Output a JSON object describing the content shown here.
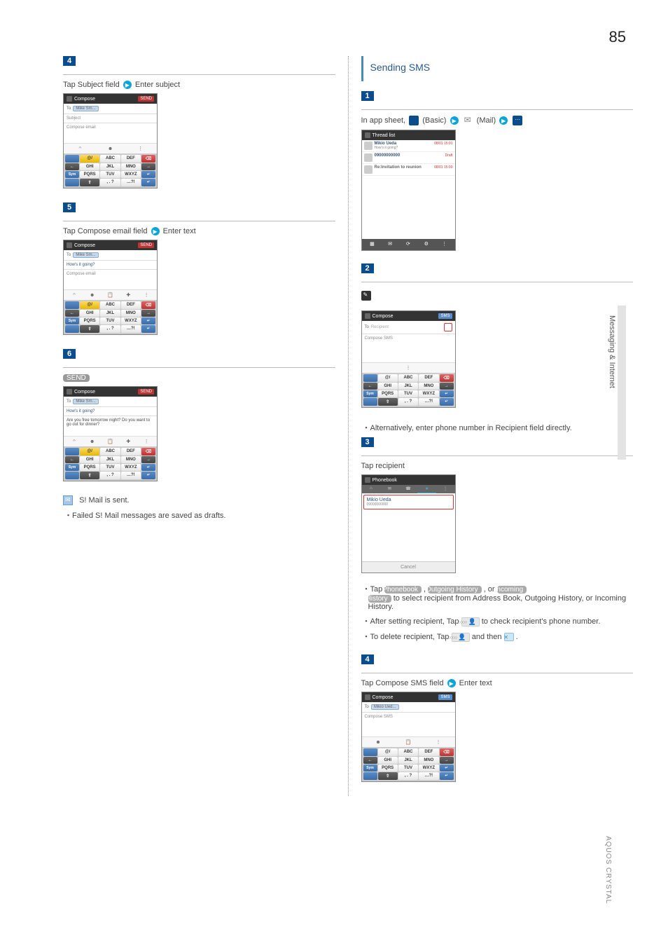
{
  "page_number": "85",
  "side_tab": "Messaging & Internet",
  "footer": "AQUOS CRYSTAL",
  "left": {
    "step4": {
      "badge": "4",
      "instr_a": "Tap Subject field",
      "instr_b": "Enter subject",
      "screen": {
        "header": "Compose",
        "send": "SEND",
        "to_label": "To",
        "chip": "Mike Sm...",
        "subject": "Subject",
        "body": "Compose email"
      }
    },
    "step5": {
      "badge": "5",
      "instr_a": "Tap Compose email field",
      "instr_b": "Enter text",
      "screen": {
        "header": "Compose",
        "send": "SEND",
        "to_label": "To",
        "chip": "Mike Sm...",
        "subject": "How's it going?",
        "body": "Compose email"
      }
    },
    "step6": {
      "badge": "6",
      "send": "SEND",
      "screen": {
        "header": "Compose",
        "send": "SEND",
        "to_label": "To",
        "chip": "Mike Sm...",
        "subject": "How's it going?",
        "body": "Are you free tomorrow night? Do you want to go out for dinner?"
      },
      "sent_text": "S! Mail is sent.",
      "note": "・Failed S! Mail messages are saved as drafts."
    },
    "keys": {
      "r1": [
        "",
        "@/",
        "ABC",
        "DEF",
        "⌫"
      ],
      "r2": [
        "←",
        "GHI",
        "JKL",
        "MNO",
        "→"
      ],
      "r3": [
        "Sym",
        "PQRS",
        "TUV",
        "WXYZ",
        "↵"
      ],
      "r4": [
        "",
        "⇧",
        ", . ?",
        "…?!",
        "↵"
      ]
    }
  },
  "right": {
    "heading": "Sending SMS",
    "step1": {
      "badge": "1",
      "instr_a": "In app sheet,",
      "instr_b": "(Basic)",
      "instr_c": "(Mail)",
      "thread": {
        "header": "Thread list",
        "items": [
          {
            "name": "Mikio Ueda",
            "preview": "How's it going?",
            "time": "08/01 15:01"
          },
          {
            "name": "09000000000",
            "preview": "",
            "time": "Draft"
          },
          {
            "name": "Re:Invitation to reunion",
            "preview": "",
            "time": "08/01 15:00"
          }
        ]
      }
    },
    "step2": {
      "badge": "2",
      "screen": {
        "header": "Compose",
        "send": "SMS",
        "to_label": "To",
        "recipient_ph": "Recipient",
        "body": "Compose SMS"
      },
      "note": "・Alternatively, enter phone number in Recipient field directly."
    },
    "step3": {
      "badge": "3",
      "instr": "Tap recipient",
      "phonebook": {
        "header": "Phonebook",
        "tabs": [
          "⌂",
          "✉",
          "☎",
          "★",
          "⋮"
        ],
        "name": "Mikio Ueda",
        "number": "09000000000",
        "cancel": "Cancel"
      },
      "notes": {
        "n1_a": "・Tap",
        "n1_phonebook": "Phonebook",
        "n1_b": ",",
        "n1_outgoing": "Outgoing History",
        "n1_c": ", or",
        "n1_incoming": "Incoming",
        "n1_history": "History",
        "n1_d": "to select recipient from Address Book, Outgoing History, or Incoming History.",
        "n2_a": "・After setting recipient, Tap",
        "n2_b": "to check recipient's phone number.",
        "n3_a": "・To delete recipient, Tap",
        "n3_b": "and then",
        "n3_c": "."
      }
    },
    "step4": {
      "badge": "4",
      "instr_a": "Tap Compose SMS field",
      "instr_b": "Enter text",
      "screen": {
        "header": "Compose",
        "send": "SMS",
        "to_label": "To",
        "chip": "Mikio Ued...",
        "body": "Compose SMS"
      }
    }
  }
}
